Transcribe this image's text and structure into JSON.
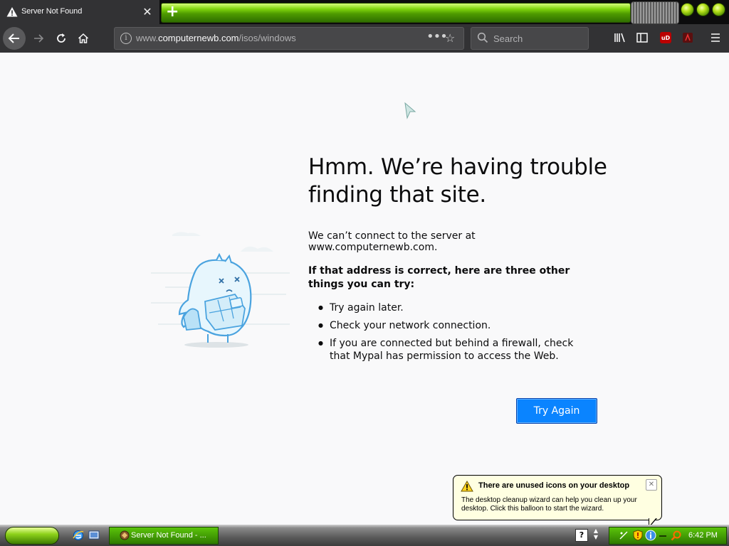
{
  "tab": {
    "title": "Server Not Found",
    "close_glyph": "✕",
    "icon": "warning-icon"
  },
  "toolbar": {
    "new_tab_glyph": "+",
    "url_prefix": "www.",
    "url_domain": "computernewb.com",
    "url_path": "/isos/windows",
    "page_actions_glyph": "•••",
    "bookmark_glyph": "☆",
    "search_placeholder": "Search",
    "library_glyph": "|||\\",
    "sidebar_glyph": "▯",
    "ublock_label": "uD",
    "menu_glyph": "☰"
  },
  "error_page": {
    "heading": "Hmm. We’re having trouble finding that site.",
    "message": "We can’t connect to the server at www.computernewb.com.",
    "subheading": "If that address is correct, here are three other things you can try:",
    "tips": [
      "Try again later.",
      "Check your network connection.",
      "If you are connected but behind a firewall, check that Mypal has permission to access the Web."
    ],
    "button_label": "Try Again",
    "accent_color": "#0a84ff"
  },
  "balloon": {
    "title": "There are unused icons on your desktop",
    "text": "The desktop cleanup wizard can help you clean up your desktop. Click this balloon to start the wizard.",
    "close_glyph": "✕"
  },
  "taskbar": {
    "task_label": "Server Not Found - ...",
    "help_glyph": "?",
    "clock": "6:42 PM",
    "theme_color": "#4ea60a"
  }
}
